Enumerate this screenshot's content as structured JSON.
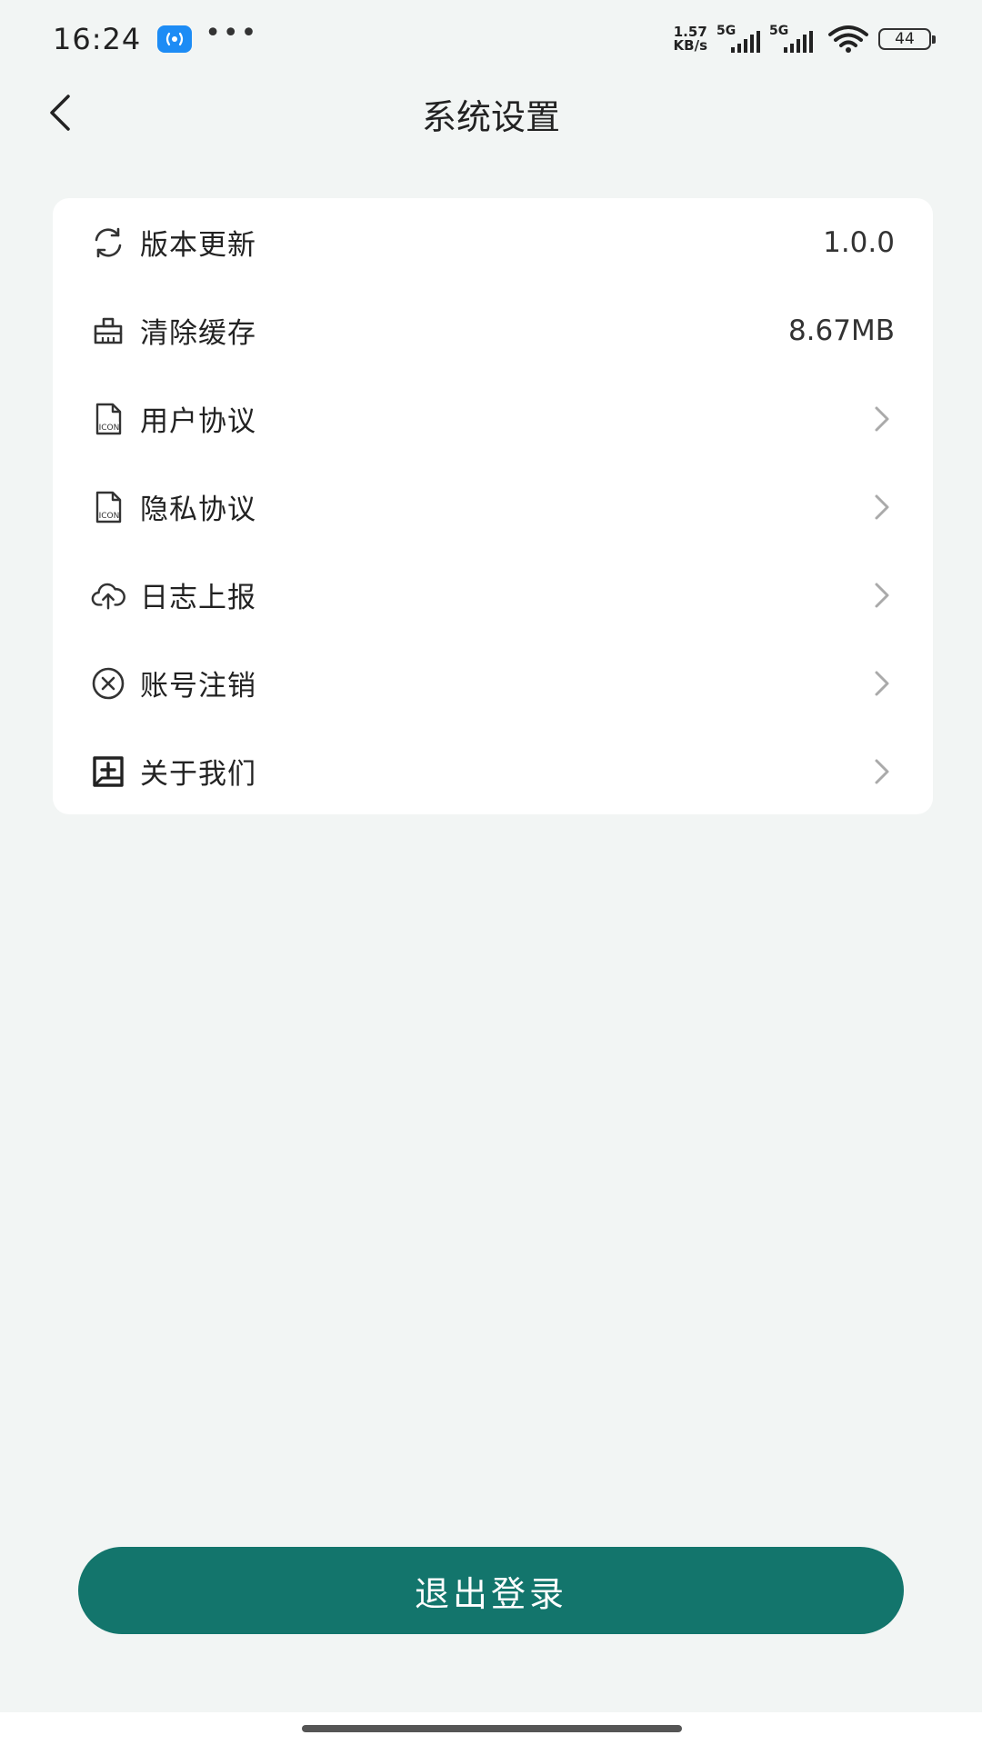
{
  "status_bar": {
    "time": "16:24",
    "net_speed_value": "1.57",
    "net_speed_unit": "KB/s",
    "sim1_label": "5G",
    "sim2_label": "5G",
    "battery_level": "44"
  },
  "header": {
    "title": "系统设置"
  },
  "settings": {
    "items": [
      {
        "label": "版本更新",
        "value": "1.0.0",
        "icon": "refresh-icon"
      },
      {
        "label": "清除缓存",
        "value": "8.67MB",
        "icon": "broom-icon"
      },
      {
        "label": "用户协议",
        "icon": "document-icon"
      },
      {
        "label": "隐私协议",
        "icon": "document-icon"
      },
      {
        "label": "日志上报",
        "icon": "cloud-upload-icon"
      },
      {
        "label": "账号注销",
        "icon": "close-circle-icon"
      },
      {
        "label": "关于我们",
        "icon": "info-box-icon"
      }
    ]
  },
  "footer": {
    "logout_label": "退出登录"
  },
  "colors": {
    "background": "#f2f5f4",
    "accent": "#13756c",
    "card": "#ffffff"
  }
}
